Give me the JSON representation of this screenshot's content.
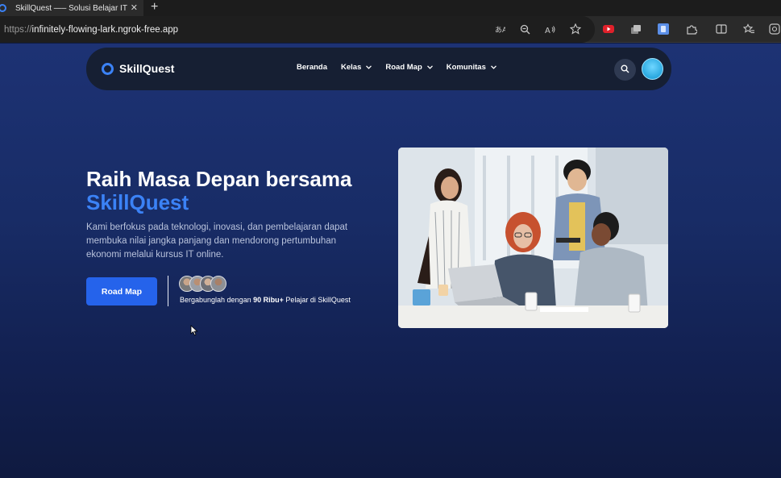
{
  "browser": {
    "tab_title": "SkillQuest —– Solusi Belajar IT",
    "tab_close": "✕",
    "new_tab": "+",
    "url_scheme": "https://",
    "url_host": "infinitely-flowing-lark.ngrok-free.app",
    "toolbar_icons": [
      "translate-icon",
      "zoom-out-icon",
      "read-aloud-icon",
      "favorite-star-icon",
      "youtube-extension-icon",
      "collections-icon",
      "extension-blue-icon",
      "extensions-icon",
      "split-screen-icon",
      "favorites-icon",
      "browser-essentials-icon"
    ]
  },
  "nav": {
    "brand": "SkillQuest",
    "items": [
      {
        "label": "Beranda",
        "has_dropdown": false
      },
      {
        "label": "Kelas",
        "has_dropdown": true
      },
      {
        "label": "Road Map",
        "has_dropdown": true
      },
      {
        "label": "Komunitas",
        "has_dropdown": true
      }
    ]
  },
  "hero": {
    "title_line1": "Raih Masa Depan bersama",
    "title_line2": "SkillQuest",
    "description": "Kami berfokus pada teknologi, inovasi, dan pembelajaran dapat membuka nilai jangka panjang dan mendorong pertumbuhan ekonomi melalui kursus IT online.",
    "cta_label": "Road Map",
    "join_prefix": "Bergabunglah dengan ",
    "join_count": "90 Ribu+",
    "join_suffix": " Pelajar di SkillQuest"
  },
  "colors": {
    "accent": "#3b82f6",
    "cta": "#2563eb",
    "navbar": "#161f33"
  }
}
